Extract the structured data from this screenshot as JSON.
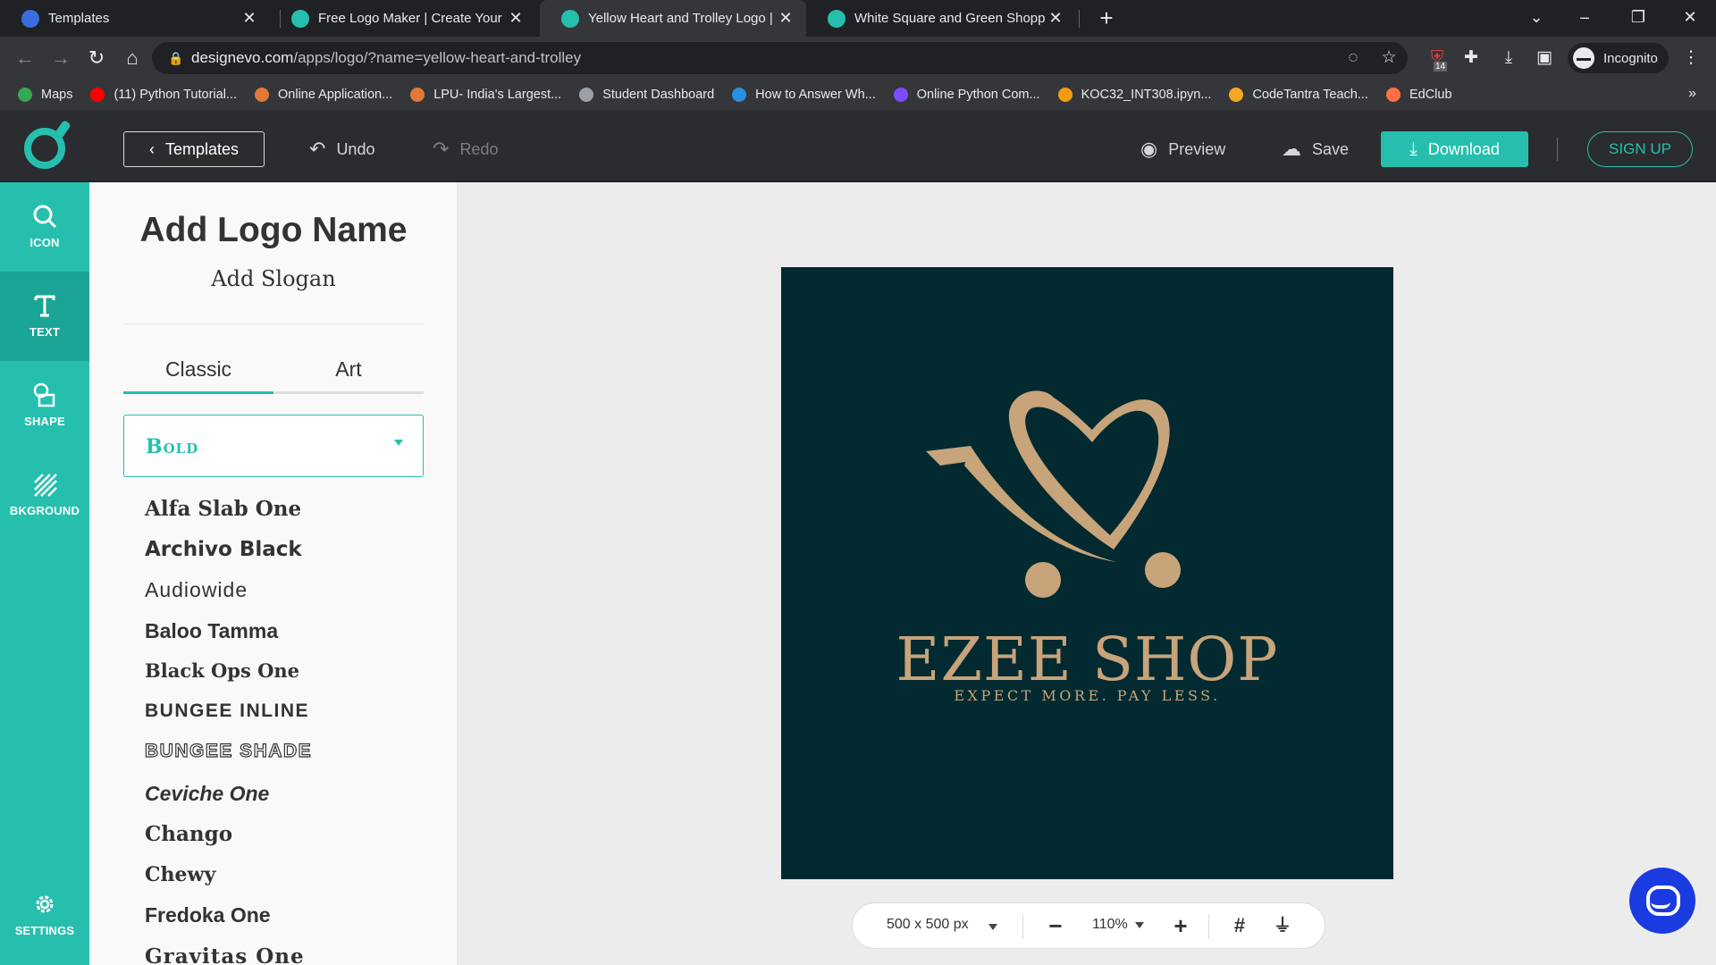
{
  "browser": {
    "tabs": [
      {
        "title": "Templates",
        "active": false
      },
      {
        "title": "Free Logo Maker | Create Your Lo",
        "active": false
      },
      {
        "title": "Yellow Heart and Trolley Logo | D",
        "active": true
      },
      {
        "title": "White Square and Green Shoppin",
        "active": false
      }
    ],
    "url_domain": "designevo.com",
    "url_path": "/apps/logo/?name=yellow-heart-and-trolley",
    "extension_badge": "14",
    "profile_label": "Incognito",
    "bookmarks": [
      {
        "label": "Maps",
        "color": "#34a853"
      },
      {
        "label": "(11) Python Tutorial...",
        "color": "#ff0000"
      },
      {
        "label": "Online Application...",
        "color": "#e0793a"
      },
      {
        "label": "LPU- India's Largest...",
        "color": "#e0793a"
      },
      {
        "label": "Student Dashboard",
        "color": "#9aa0a6"
      },
      {
        "label": "How to Answer Wh...",
        "color": "#2b8fe0"
      },
      {
        "label": "Online Python Com...",
        "color": "#7c4dff"
      },
      {
        "label": "KOC32_INT308.ipyn...",
        "color": "#f39c12"
      },
      {
        "label": "CodeTantra Teach...",
        "color": "#f5a623"
      },
      {
        "label": "EdClub",
        "color": "#ff7043"
      }
    ]
  },
  "app": {
    "accent": "#26bfae",
    "header": {
      "templates_label": "Templates",
      "undo_label": "Undo",
      "redo_label": "Redo",
      "preview_label": "Preview",
      "save_label": "Save",
      "download_label": "Download",
      "signup_label": "SIGN UP"
    },
    "rail": [
      {
        "label": "ICON",
        "icon": "search-icon"
      },
      {
        "label": "TEXT",
        "icon": "text-icon"
      },
      {
        "label": "SHAPE",
        "icon": "shape-icon"
      },
      {
        "label": "BKGROUND",
        "icon": "background-icon"
      },
      {
        "label": "SETTINGS",
        "icon": "gear-icon"
      }
    ],
    "panel": {
      "logo_name": "Add Logo Name",
      "slogan": "Add Slogan",
      "tabs": [
        "Classic",
        "Art"
      ],
      "font_category": "Bold",
      "fonts": [
        "Alfa Slab One",
        "Archivo Black",
        "Audiowide",
        "Baloo Tamma",
        "Black Ops One",
        "BUNGEE INLINE",
        "BUNGEE SHADE",
        "Ceviche One",
        "Chango",
        "Chewy",
        "Fredoka One",
        "Gravitas One"
      ]
    },
    "canvas": {
      "background_color": "#032a31",
      "brand_color": "#c7a47a",
      "brand_name": "EZEE SHOP",
      "tagline": "EXPECT MORE. PAY LESS."
    },
    "zoom": {
      "size_label": "500 x 500 px",
      "zoom_label": "110%"
    }
  }
}
